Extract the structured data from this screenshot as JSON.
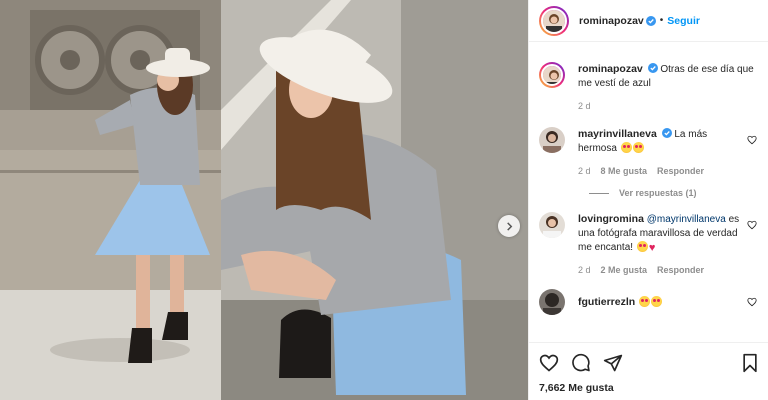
{
  "post": {
    "author": "rominapozav",
    "separator": "•",
    "follow_label": "Seguir",
    "caption": "Otras de ese día que me vestí de azul",
    "time": "2 d",
    "likes": "7,662 Me gusta"
  },
  "comments": [
    {
      "user": "mayrinvillaneva",
      "verified": true,
      "text": "La más hermosa",
      "emojis": [
        "heart-eyes-emoji",
        "heart-eyes-emoji"
      ],
      "time": "2 d",
      "likes": "8 Me gusta",
      "reply_label": "Responder",
      "view_replies": "Ver respuestas (1)"
    },
    {
      "user": "lovingromina",
      "mention": "@mayrinvillaneva",
      "text": "es una fotógrafa maravillosa de verdad me encanta!",
      "emojis": [
        "heart-eyes-emoji",
        "red-heart-emoji"
      ],
      "time": "2 d",
      "likes": "2 Me gusta",
      "reply_label": "Responder"
    },
    {
      "user": "fgutierrezln",
      "emojis": [
        "heart-eyes-emoji",
        "heart-eyes-emoji"
      ]
    }
  ],
  "icons": [
    "verified-icon",
    "heart-icon",
    "comment-icon",
    "share-icon",
    "bookmark-icon",
    "chevron-right-icon"
  ],
  "colors": {
    "accent": "#0095f6",
    "muted": "#8e8e8e",
    "verified": "#3897f0",
    "heart": "#e0245e"
  }
}
